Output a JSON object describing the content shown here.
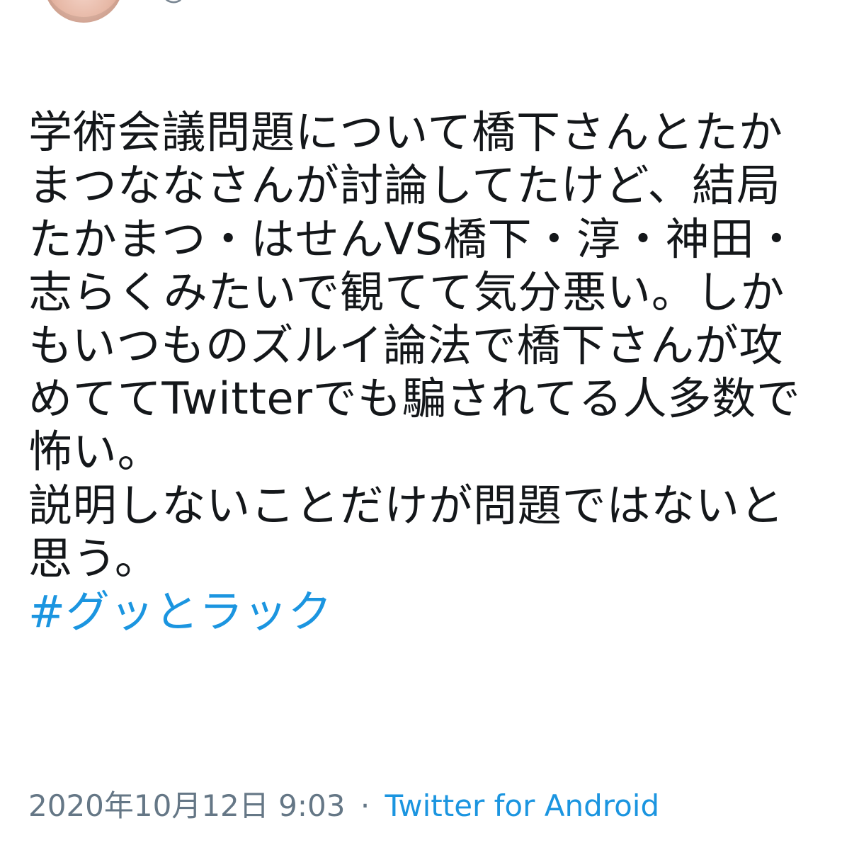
{
  "tweet": {
    "handle": "@",
    "text": "学術会議問題について橋下さんとたかまつななさんが討論してたけど、結局たかまつ・はせんVS橋下・淳・神田・志らくみたいで観てて気分悪い。しかもいつものズルイ論法で橋下さんが攻めててTwitterでも騙されてる人多数で怖い。\n説明しないことだけが問題ではないと思う。",
    "hashtag": "#グッとラック",
    "timestamp": "2020年10月12日 9:03",
    "separator": "·",
    "source": "Twitter for Android"
  },
  "colors": {
    "text": "#14171a",
    "link": "#1b95e0",
    "meta": "#657786"
  }
}
